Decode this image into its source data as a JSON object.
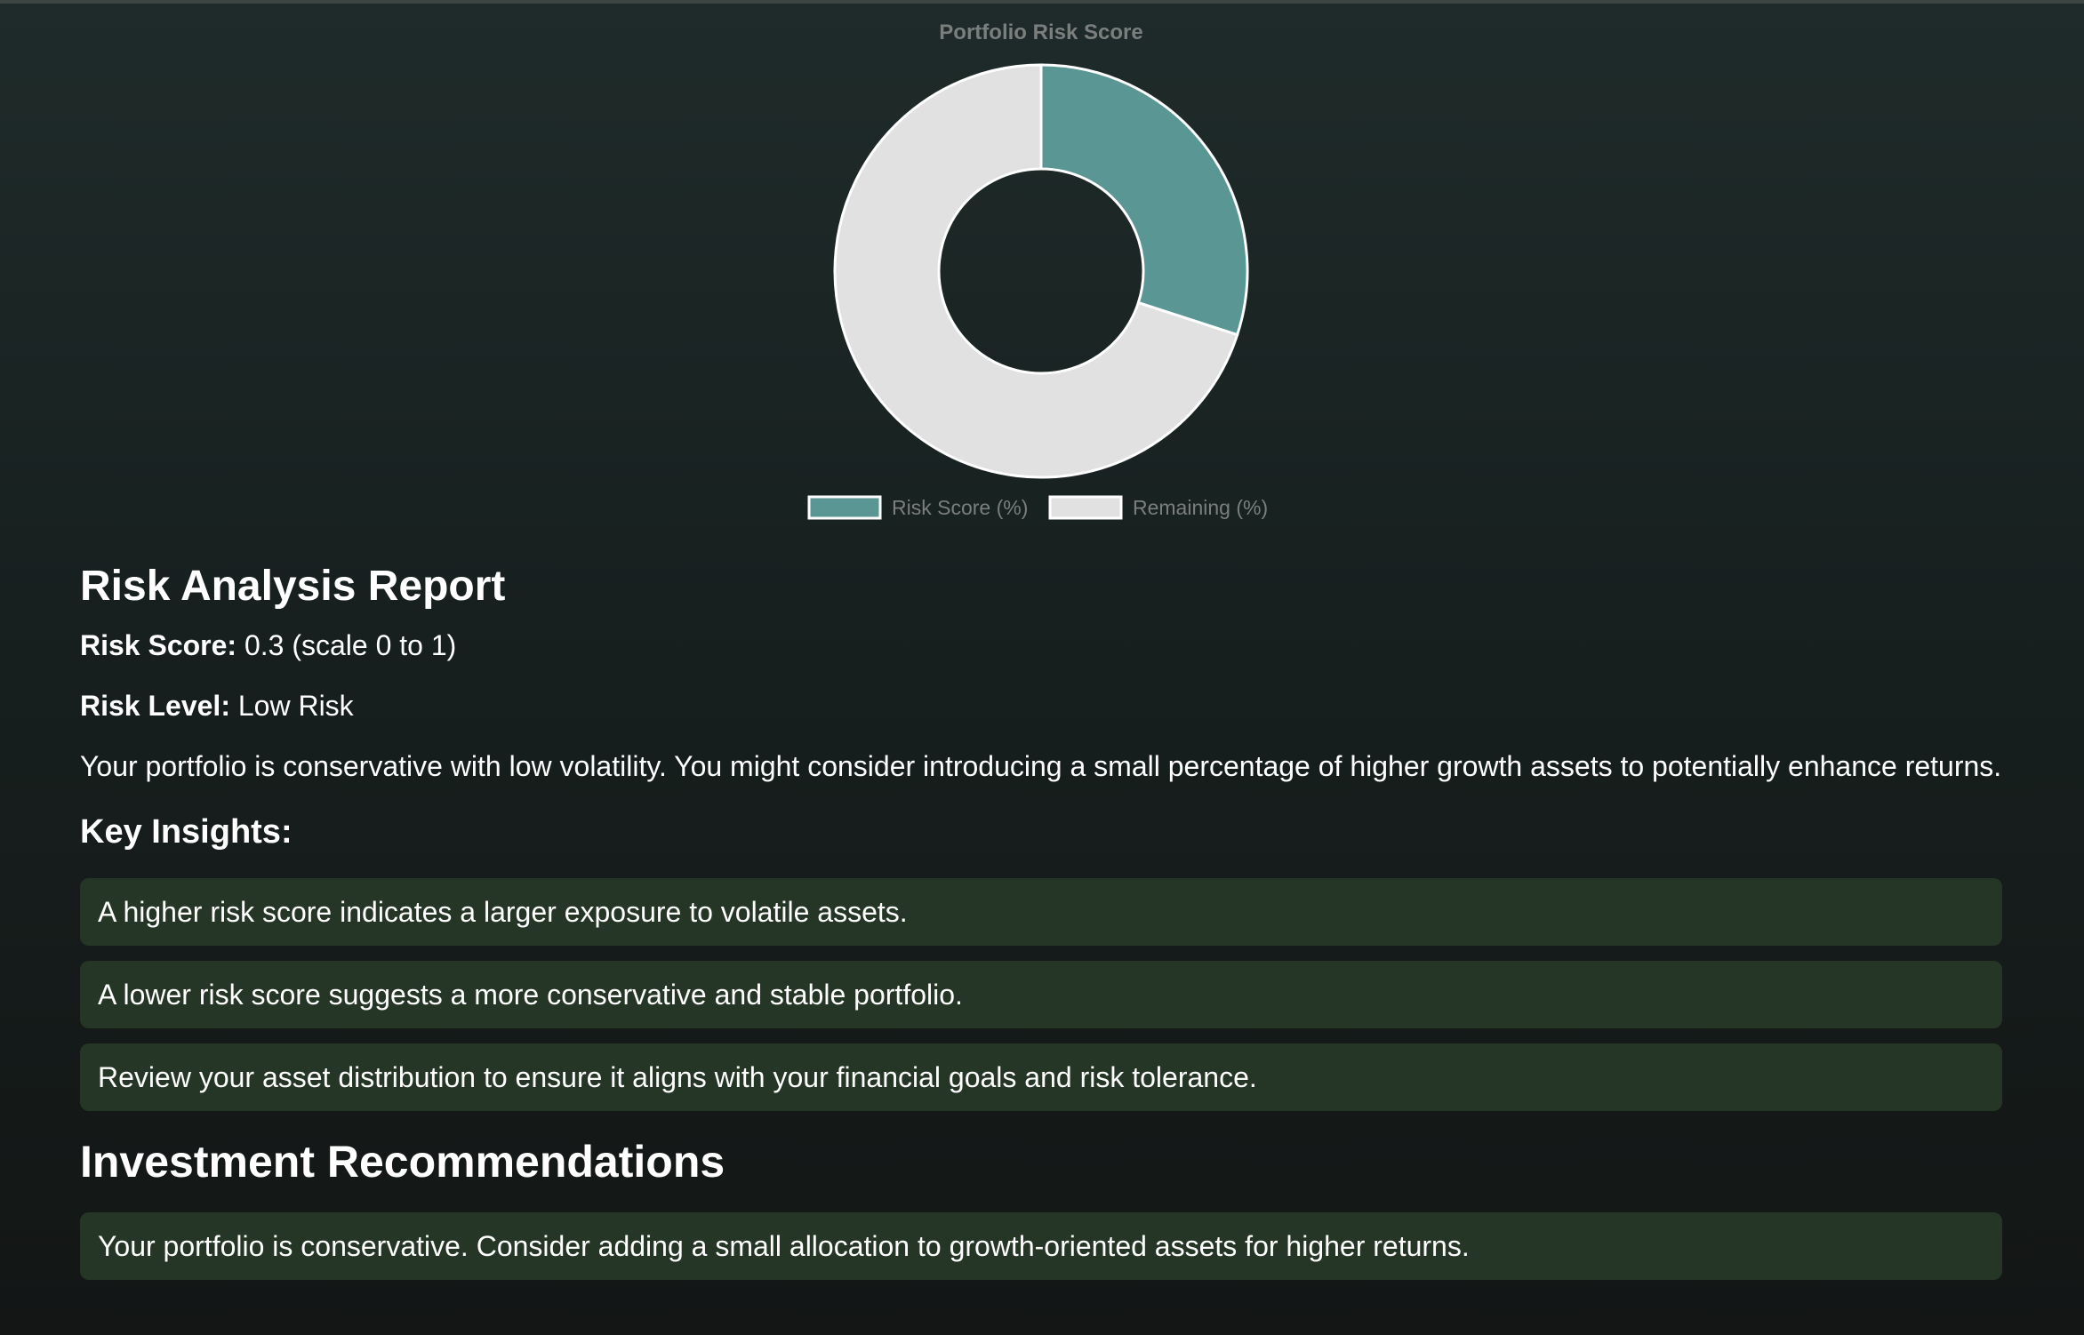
{
  "chart_data": {
    "type": "pie",
    "title": "Portfolio Risk Score",
    "categories": [
      "Risk Score (%)",
      "Remaining (%)"
    ],
    "values": [
      30,
      70
    ],
    "colors": [
      "#5a9693",
      "#e1e1e1"
    ],
    "legend_position": "bottom"
  },
  "report": {
    "title": "Risk Analysis Report",
    "risk_score_label": "Risk Score:",
    "risk_score_value": " 0.3 (scale 0 to 1)",
    "risk_level_label": "Risk Level:",
    "risk_level_value": " Low Risk",
    "summary": "Your portfolio is conservative with low volatility. You might consider introducing a small percentage of higher growth assets to potentially enhance returns."
  },
  "insights": {
    "title": "Key Insights:",
    "items": [
      "A higher risk score indicates a larger exposure to volatile assets.",
      "A lower risk score suggests a more conservative and stable portfolio.",
      "Review your asset distribution to ensure it aligns with your financial goals and risk tolerance."
    ]
  },
  "recommendations": {
    "title": "Investment Recommendations",
    "items": [
      "Your portfolio is conservative. Consider adding a small allocation to growth-oriented assets for higher returns."
    ]
  },
  "colors": {
    "accent": "#5a9693",
    "card_bg": "#263626"
  }
}
